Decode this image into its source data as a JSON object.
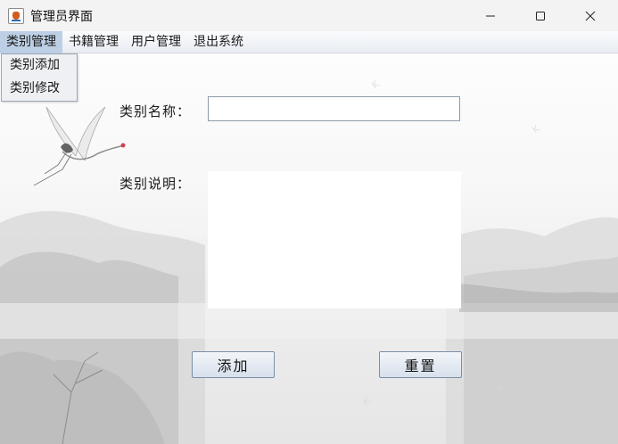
{
  "window": {
    "title": "管理员界面",
    "icon": "java-cup-icon"
  },
  "window_controls": {
    "minimize_icon": "minimize-icon",
    "maximize_icon": "maximize-icon",
    "close_icon": "close-icon"
  },
  "menubar": {
    "items": [
      {
        "label": "类别管理",
        "active": true
      },
      {
        "label": "书籍管理"
      },
      {
        "label": "用户管理"
      },
      {
        "label": "退出系统"
      }
    ]
  },
  "dropdown": {
    "items": [
      {
        "label": "类别添加"
      },
      {
        "label": "类别修改"
      }
    ]
  },
  "form": {
    "name_label": "类别名称：",
    "name_value": "",
    "desc_label": "类别说明：",
    "desc_value": "",
    "add_button": "添加",
    "reset_button": "重置"
  },
  "colors": {
    "menu_active": "#bccfe4",
    "button_border": "#7c8fa8"
  }
}
